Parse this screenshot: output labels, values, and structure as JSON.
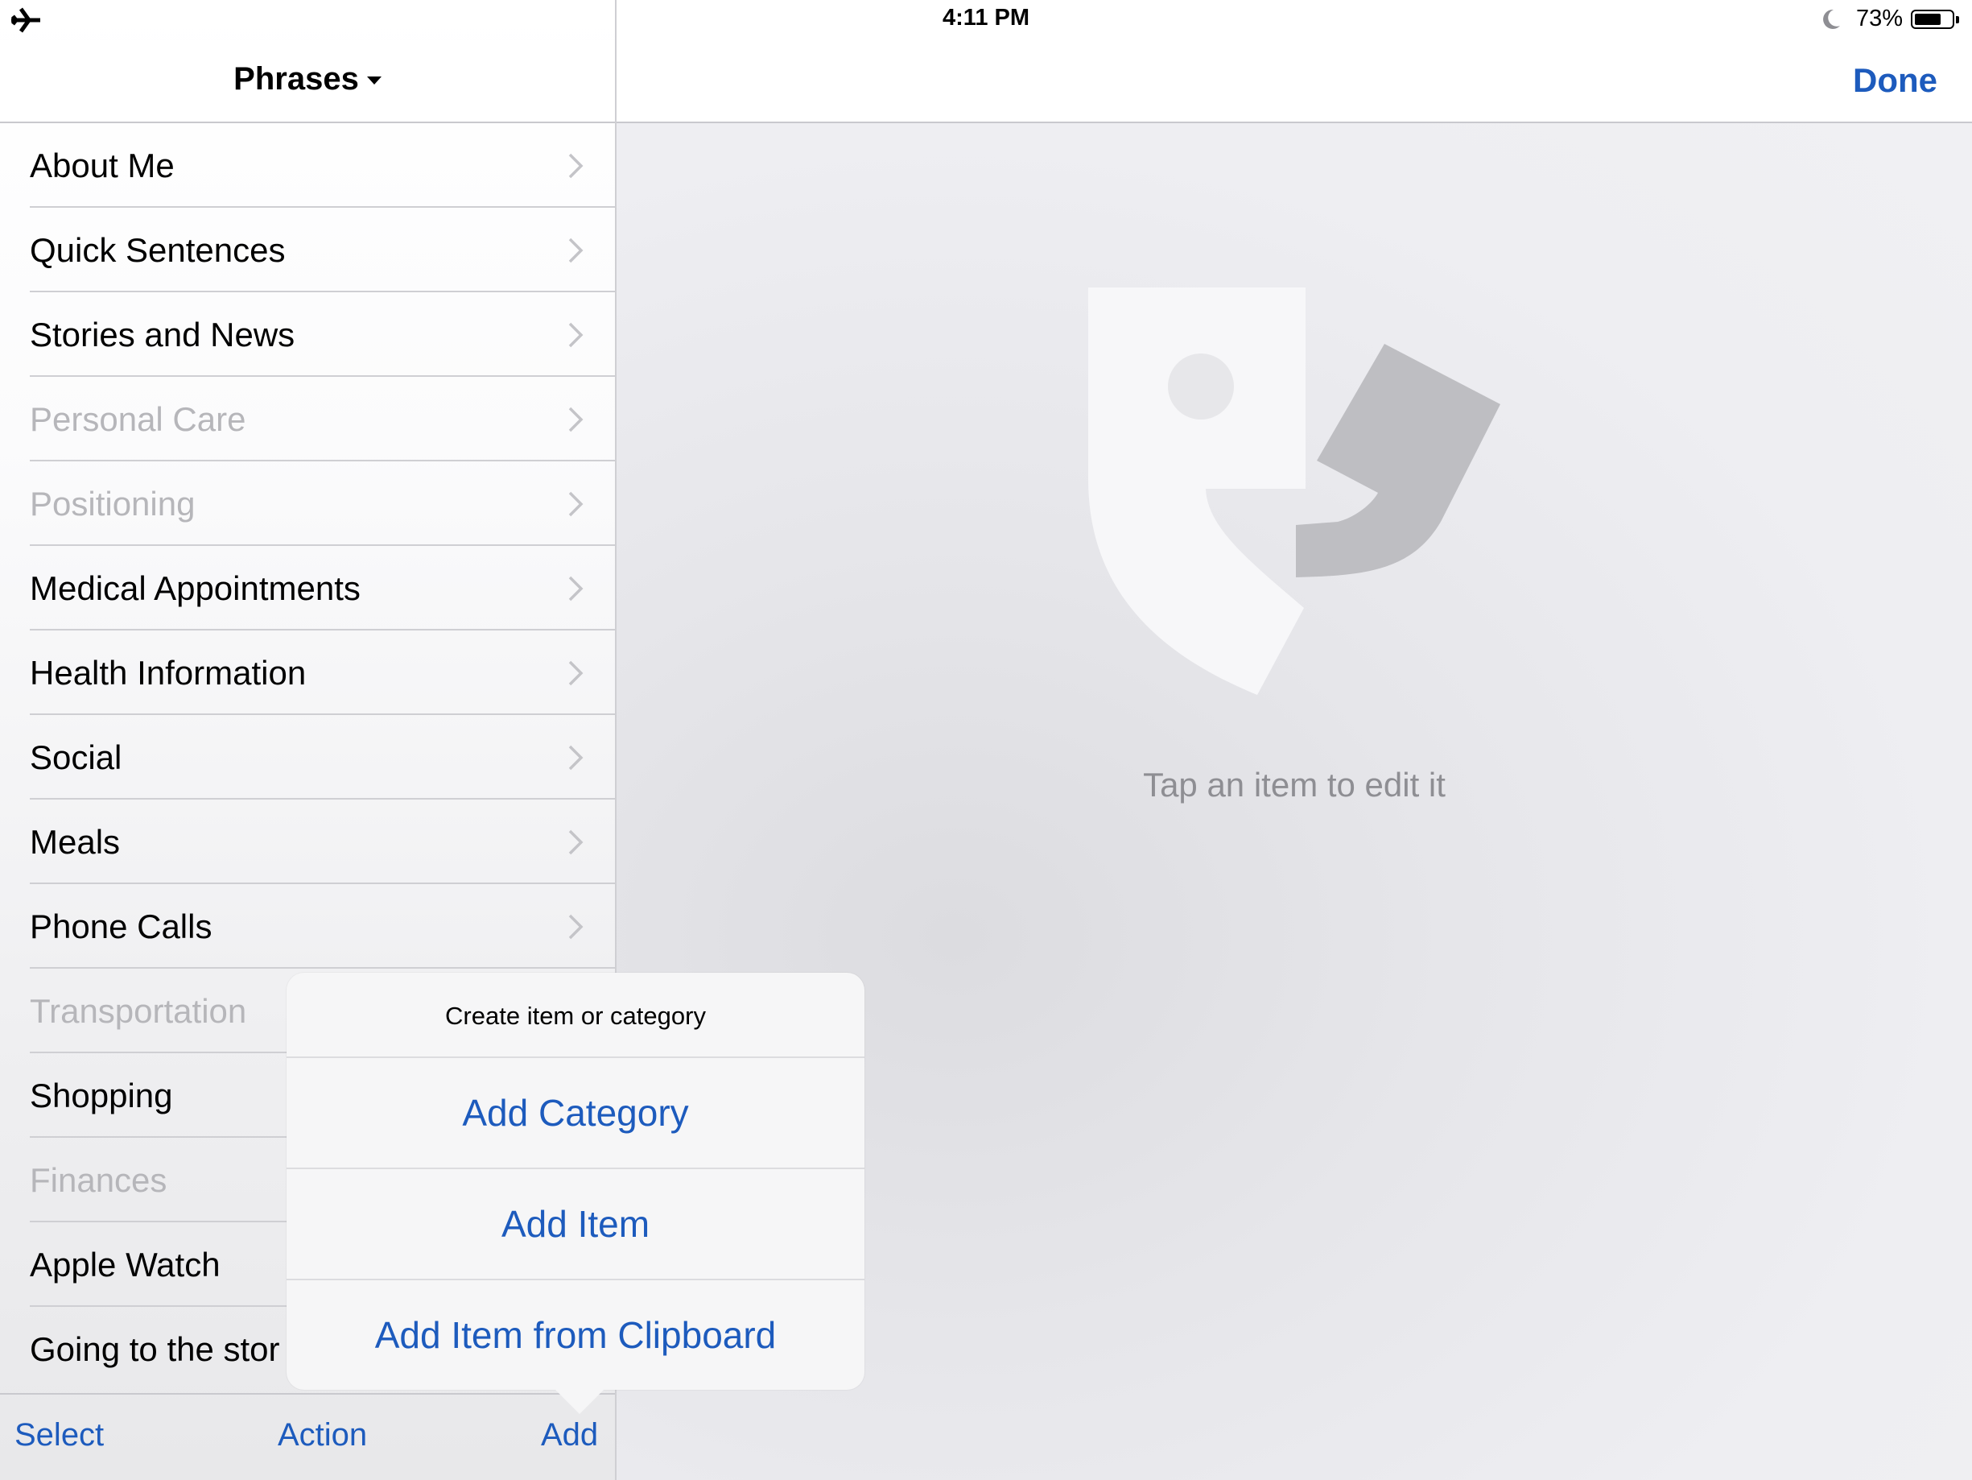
{
  "status_bar": {
    "time": "4:11 PM",
    "battery_percent": "73%",
    "battery_level": 0.73,
    "icons": [
      "airplane-icon",
      "moon-icon",
      "battery-icon"
    ]
  },
  "master": {
    "title": "Phrases",
    "items": [
      {
        "label": "About Me",
        "dimmed": false
      },
      {
        "label": "Quick Sentences",
        "dimmed": false
      },
      {
        "label": "Stories and News",
        "dimmed": false
      },
      {
        "label": "Personal Care",
        "dimmed": true
      },
      {
        "label": "Positioning",
        "dimmed": true
      },
      {
        "label": "Medical Appointments",
        "dimmed": false
      },
      {
        "label": "Health Information",
        "dimmed": false
      },
      {
        "label": "Social",
        "dimmed": false
      },
      {
        "label": "Meals",
        "dimmed": false
      },
      {
        "label": "Phone Calls",
        "dimmed": false
      },
      {
        "label": "Transportation",
        "dimmed": true
      },
      {
        "label": "Shopping",
        "dimmed": false
      },
      {
        "label": "Finances",
        "dimmed": true
      },
      {
        "label": "Apple Watch",
        "dimmed": false
      },
      {
        "label": "Going to the stor",
        "dimmed": false
      }
    ],
    "toolbar": {
      "select": "Select",
      "action": "Action",
      "add": "Add"
    }
  },
  "detail": {
    "done": "Done",
    "hint": "Tap an item to edit it"
  },
  "popover": {
    "title": "Create item or category",
    "buttons": [
      "Add Category",
      "Add Item",
      "Add Item from Clipboard"
    ]
  },
  "colors": {
    "accent": "#1d5bbd",
    "dimmed_text": "#b6b6ba",
    "hint_text": "#8e8e93"
  }
}
